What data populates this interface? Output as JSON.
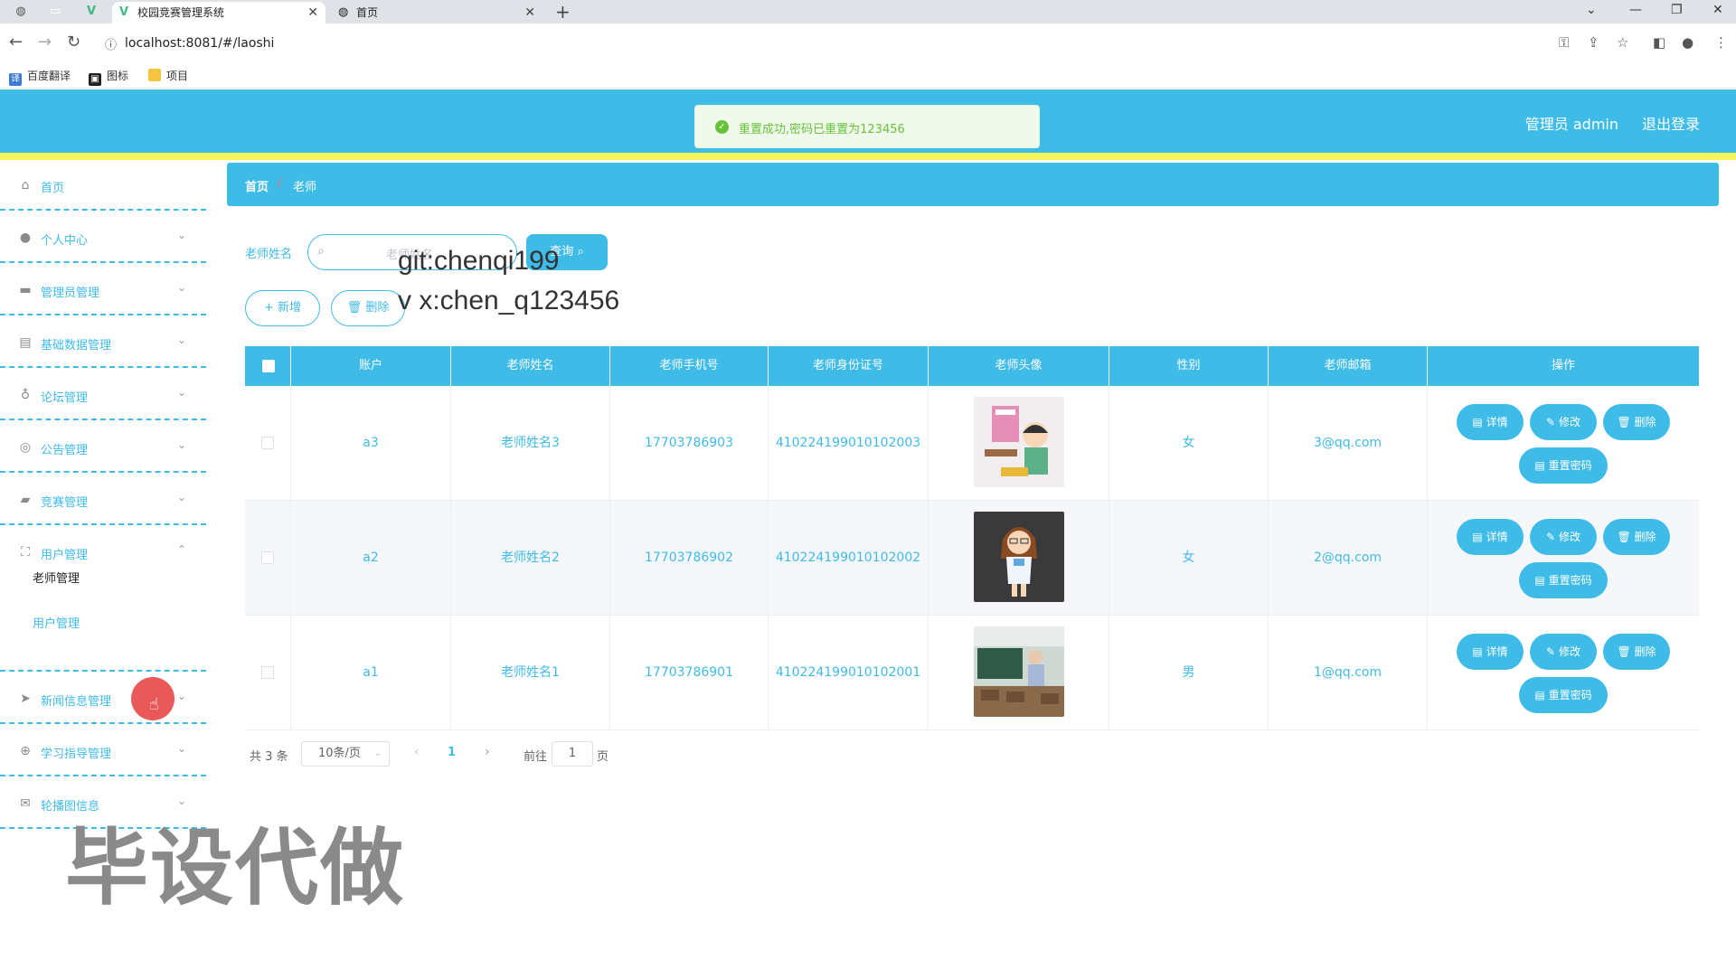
{
  "browser": {
    "tabs": [
      {
        "label": "校园竞赛管理系统",
        "active": true
      },
      {
        "label": "首页",
        "active": false
      }
    ],
    "url": "localhost:8081/#/laoshi",
    "bookmarks": [
      "百度翻译",
      "图标",
      "项目"
    ]
  },
  "header": {
    "user": "管理员 admin",
    "logout": "退出登录",
    "toast": "重置成功,密码已重置为123456",
    "bg_color": "#3fbbe8",
    "stripe_color": "#f8f35a"
  },
  "sidebar": {
    "items": [
      {
        "label": "首页",
        "icon": "home-icon"
      },
      {
        "label": "个人中心",
        "icon": "user-icon"
      },
      {
        "label": "管理员管理",
        "icon": "admin-icon"
      },
      {
        "label": "基础数据管理",
        "icon": "data-icon"
      },
      {
        "label": "论坛管理",
        "icon": "mic-icon"
      },
      {
        "label": "公告管理",
        "icon": "compass-icon"
      },
      {
        "label": "竞赛管理",
        "icon": "wallet-icon"
      },
      {
        "label": "用户管理",
        "icon": "fullscreen-icon"
      },
      {
        "label": "新闻信息管理",
        "icon": "send-icon"
      },
      {
        "label": "学习指导管理",
        "icon": "target-icon"
      },
      {
        "label": "轮播图信息",
        "icon": "mail-icon"
      }
    ],
    "sub_items": [
      "老师管理",
      "用户管理"
    ]
  },
  "breadcrumb": {
    "home": "首页",
    "sep": "/",
    "current": "老师"
  },
  "search": {
    "label": "老师姓名",
    "placeholder": "老师姓名",
    "button": "查询"
  },
  "actions": {
    "add": "+ 新增",
    "delete": "删除"
  },
  "watermarks": {
    "git": "git:chenqi199",
    "vx": "v x:chen_q123456",
    "big": "毕设代做"
  },
  "table": {
    "columns": [
      "账户",
      "老师姓名",
      "老师手机号",
      "老师身份证号",
      "老师头像",
      "性别",
      "老师邮箱",
      "操作"
    ],
    "rows": [
      {
        "account": "a3",
        "name": "老师姓名3",
        "phone": "17703786903",
        "id_card": "410224199010102003",
        "gender": "女",
        "email": "3@qq.com"
      },
      {
        "account": "a2",
        "name": "老师姓名2",
        "phone": "17703786902",
        "id_card": "410224199010102002",
        "gender": "女",
        "email": "2@qq.com"
      },
      {
        "account": "a1",
        "name": "老师姓名1",
        "phone": "17703786901",
        "id_card": "410224199010102001",
        "gender": "男",
        "email": "1@qq.com"
      }
    ],
    "ops": {
      "detail": "详情",
      "edit": "修改",
      "delete": "删除",
      "reset": "重置密码"
    }
  },
  "pagination": {
    "total": "共 3 条",
    "page_size": "10条/页",
    "current_page": "1",
    "goto": "前往",
    "jump_value": "1",
    "unit": "页"
  }
}
